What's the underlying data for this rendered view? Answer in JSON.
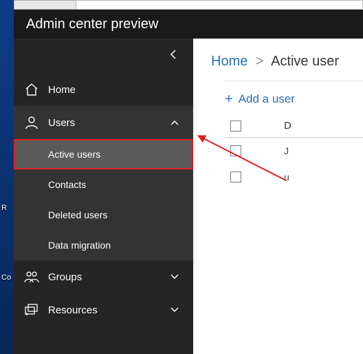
{
  "titlebar": {
    "title": "Admin center preview"
  },
  "sidebar": {
    "items": [
      {
        "label": "Home"
      },
      {
        "label": "Users"
      },
      {
        "label": "Groups"
      },
      {
        "label": "Resources"
      }
    ],
    "users_sub": [
      {
        "label": "Active users"
      },
      {
        "label": "Contacts"
      },
      {
        "label": "Deleted users"
      },
      {
        "label": "Data migration"
      }
    ]
  },
  "breadcrumb": {
    "home": "Home",
    "sep": ">",
    "current": "Active user"
  },
  "toolbar": {
    "add_user": "Add a user"
  },
  "table": {
    "col0": "D",
    "rows": [
      {
        "v": "J"
      },
      {
        "v": "u"
      }
    ]
  },
  "desktop": {
    "icon_r": "R",
    "icon_co": "Co"
  }
}
